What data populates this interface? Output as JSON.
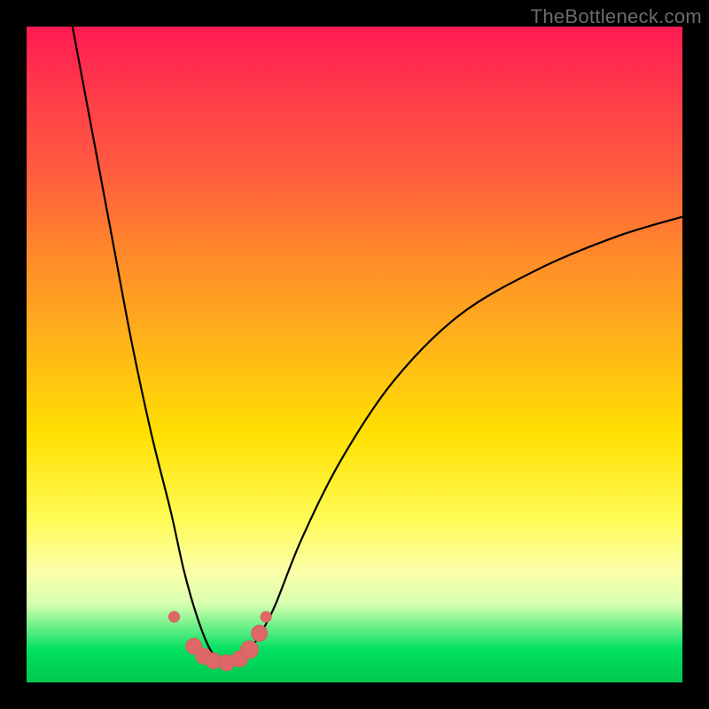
{
  "watermark": "TheBottleneck.com",
  "colors": {
    "frame_bg": "#000000",
    "curve_stroke": "#000000",
    "marker_fill": "#de6868",
    "marker_stroke": "#d65f5f"
  },
  "chart_data": {
    "type": "line",
    "title": "",
    "xlabel": "",
    "ylabel": "",
    "xlim": [
      0,
      100
    ],
    "ylim": [
      0,
      100
    ],
    "note": "x and y are in percent of the plot area; y=0 at bottom, y=100 at top. Curve depicts a V-shaped bottleneck profile with minimum around x≈30.",
    "series": [
      {
        "name": "bottleneck-curve",
        "x": [
          7,
          10,
          13,
          16,
          19,
          22,
          24,
          26,
          28,
          30,
          32,
          34,
          36,
          38,
          42,
          48,
          56,
          66,
          78,
          90,
          100
        ],
        "y": [
          100,
          84,
          68,
          52,
          38,
          26,
          17,
          10,
          5,
          3,
          3.5,
          5,
          8,
          12,
          22,
          34,
          46,
          56,
          63,
          68,
          71
        ]
      }
    ],
    "markers": {
      "name": "highlight-points",
      "x": [
        22.5,
        25.5,
        27.0,
        28.5,
        30.5,
        32.5,
        34.0,
        35.5,
        36.5
      ],
      "y": [
        10.0,
        5.5,
        4.0,
        3.3,
        3.0,
        3.6,
        5.0,
        7.5,
        10.0
      ],
      "r": [
        6,
        9,
        9,
        9,
        9,
        9,
        10,
        9,
        6
      ]
    }
  }
}
